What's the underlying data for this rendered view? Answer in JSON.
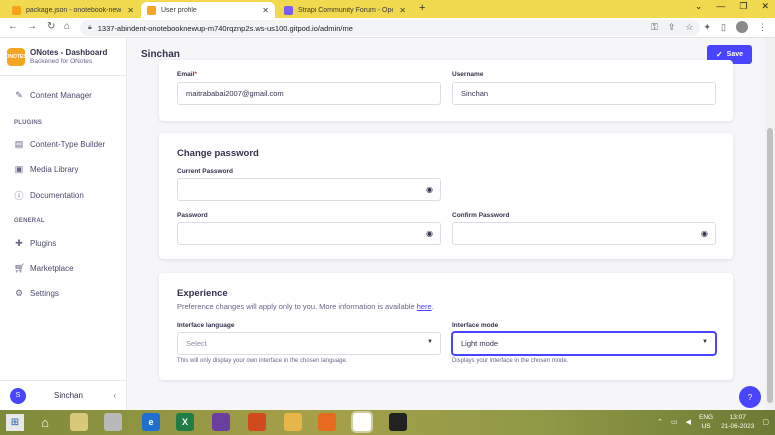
{
  "browser": {
    "tabs": [
      {
        "title": "package.json - onotebook-new-",
        "favicon_color": "#f7a21b",
        "active": false
      },
      {
        "title": "User profile",
        "favicon_color": "#f5a524",
        "active": true
      },
      {
        "title": "Strapi Community Forum - Ope",
        "favicon_color": "#7b5cff",
        "active": false
      }
    ],
    "url": "1337-abindent-onotebooknewup-m740rqznp2s.ws-us100.gitpod.io/admin/me",
    "icons": {
      "back": "back-arrow-icon",
      "forward": "forward-arrow-icon",
      "reload": "reload-icon",
      "home": "home-icon"
    }
  },
  "app": {
    "brand_title": "ONotes - Dashboard",
    "brand_subtitle": "Backened for ONotes",
    "logo_text": "ONOTES",
    "nav": {
      "content_manager": "Content Manager",
      "plugins_section": "PLUGINS",
      "ctb": "Content-Type Builder",
      "media": "Media Library",
      "docs": "Documentation",
      "general_section": "GENERAL",
      "plugins": "Plugins",
      "marketplace": "Marketplace",
      "settings": "Settings"
    },
    "user_initial": "S",
    "user_name": "Sinchan"
  },
  "page": {
    "title": "Sinchan",
    "save_label": "Save",
    "profile": {
      "email_label": "Email",
      "email_required": "*",
      "email_value": "maitrababai2007@gmail.com",
      "username_label": "Username",
      "username_value": "Sinchan"
    },
    "password": {
      "heading": "Change password",
      "current_label": "Current Password",
      "password_label": "Password",
      "confirm_label": "Confirm Password"
    },
    "experience": {
      "heading": "Experience",
      "desc_text": "Preference changes will apply only to you. More information is available ",
      "desc_link": "here",
      "desc_end": ".",
      "language_label": "Interface language",
      "language_placeholder": "Select",
      "language_hint": "This will only display your own interface in the chosen language.",
      "mode_label": "Interface mode",
      "mode_value": "Light mode",
      "mode_hint": "Displays your interface in the chosen mode."
    },
    "help_label": "?"
  },
  "taskbar": {
    "lang_top": "ENG",
    "lang_bottom": "US",
    "time": "13:07",
    "date": "21-06-2023"
  },
  "colors": {
    "primary": "#4945ff",
    "tabstrip": "#f1d94f",
    "required": "#d02b20"
  }
}
